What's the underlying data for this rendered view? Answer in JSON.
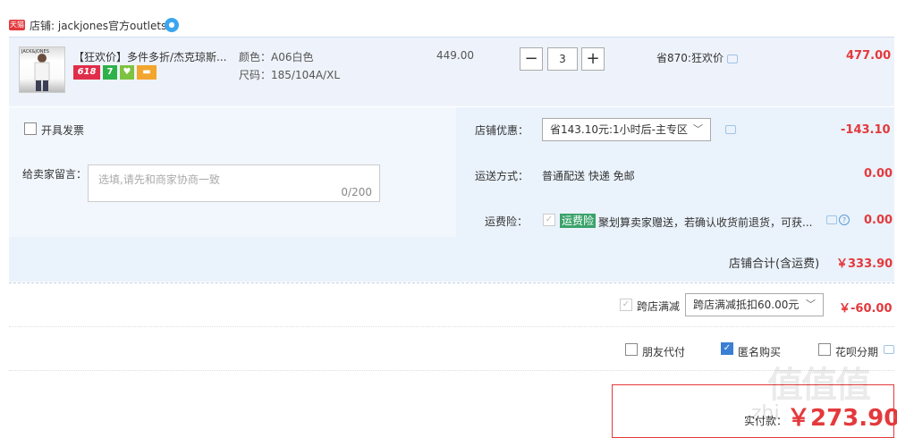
{
  "shop": {
    "badge": "天猫",
    "name": "店铺: jackjones官方outlets"
  },
  "item": {
    "thumb_brand": "JACK&JONES",
    "title": "【狂欢价】多件多折/杰克琼斯...",
    "badges": [
      "618",
      "7",
      "",
      ""
    ],
    "color": "颜色：A06白色",
    "size": "尺码：185/104A/XL",
    "unit_price": "449.00",
    "qty_minus": "−",
    "quantity": "3",
    "qty_plus": "+",
    "promo": "省870:狂欢价",
    "total": "477.00"
  },
  "options": {
    "invoice_label": "开具发票",
    "message_label": "给卖家留言：",
    "message_placeholder": "选填,请先和商家协商一致",
    "message_count": "0/200",
    "store_discount_label": "店铺优惠：",
    "store_discount_value": "省143.10元:1小时后-主专区",
    "store_discount_amount": "-143.10",
    "shipping_label": "运送方式：",
    "shipping_value": "普通配送 快递 免邮",
    "shipping_amount": "0.00",
    "insurance_label": "运费险：",
    "insurance_tag": "运费险",
    "insurance_text": "聚划算卖家赠送，若确认收货前退货，可获...",
    "insurance_amount": "0.00"
  },
  "store_total": {
    "label": "店铺合计(含运费)",
    "amount": "￥333.90"
  },
  "cross_store": {
    "label": "跨店满减",
    "select_value": "跨店满减抵扣60.00元",
    "amount": "￥-60.00"
  },
  "payment_options": {
    "friend_pay": "朋友代付",
    "anonymous": "匿名购买",
    "huabei": "花呗分期"
  },
  "pay": {
    "label": "实付款：",
    "amount": "￥273.90"
  },
  "watermark": {
    "text": "值值值",
    "sub": "zhi"
  }
}
